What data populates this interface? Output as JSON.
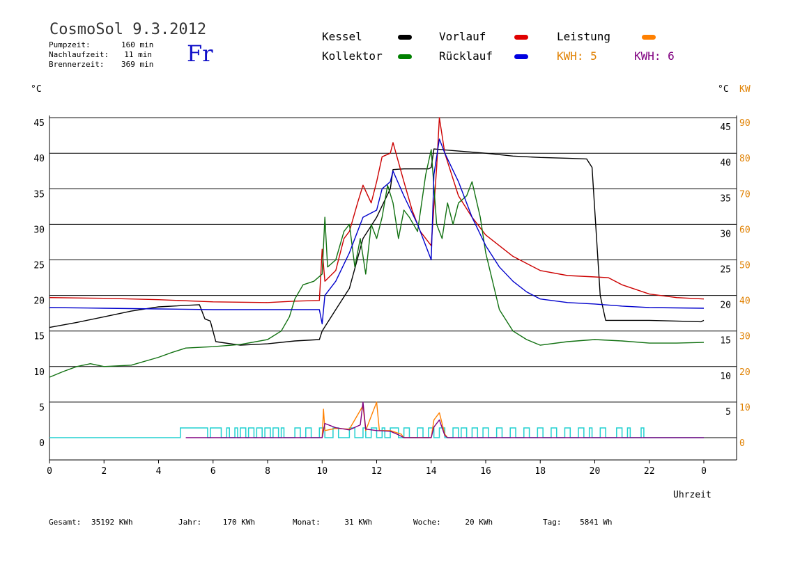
{
  "header": {
    "title": "CosmoSol 9.3.2012",
    "day": "Fr",
    "stats": [
      {
        "label": "Pumpzeit:",
        "value": "160 min"
      },
      {
        "label": "Nachlaufzeit:",
        "value": "11 min"
      },
      {
        "label": "Brennerzeit:",
        "value": "369 min"
      }
    ]
  },
  "legend": [
    {
      "name": "Kessel",
      "color": "#000000"
    },
    {
      "name": "Vorlauf",
      "color": "#e00000"
    },
    {
      "name": "Leistung",
      "color": "#ff8000"
    },
    {
      "name": "Kollektor",
      "color": "#008000"
    },
    {
      "name": "Rücklauf",
      "color": "#0000e0"
    }
  ],
  "kwh": [
    {
      "text": "KWH: 5",
      "color": "#e08000"
    },
    {
      "text": "KWH: 6",
      "color": "#800080"
    }
  ],
  "footer": [
    {
      "label": "Gesamt:",
      "value": "35192 KWh"
    },
    {
      "label": "Jahr:",
      "value": "170 KWh"
    },
    {
      "label": "Monat:",
      "value": "31 KWh"
    },
    {
      "label": "Woche:",
      "value": "20 KWh"
    },
    {
      "label": "Tag:",
      "value": "5841 Wh"
    }
  ],
  "chart_data": {
    "type": "line",
    "xlabel": "Uhrzeit",
    "ylabel_left": "°C",
    "ylabel_right": "°C",
    "ylabel_kw": "KW",
    "x_ticks": [
      "0",
      "2",
      "4",
      "6",
      "8",
      "10",
      "12",
      "14",
      "16",
      "18",
      "20",
      "22",
      "0"
    ],
    "y_ticks_left": [
      "0",
      "5",
      "10",
      "15",
      "20",
      "25",
      "30",
      "35",
      "40",
      "45"
    ],
    "y_ticks_right": [
      "5",
      "10",
      "15",
      "20",
      "25",
      "30",
      "35",
      "40",
      "45"
    ],
    "y_ticks_kw": [
      "0",
      "10",
      "20",
      "30",
      "40",
      "50",
      "60",
      "70",
      "80",
      "90"
    ],
    "xlim": [
      0,
      24
    ],
    "ylim": [
      0,
      45
    ],
    "grid": true,
    "series": [
      {
        "name": "Kessel",
        "color": "#000000",
        "points": [
          [
            0,
            15.5
          ],
          [
            1,
            16.2
          ],
          [
            2,
            17
          ],
          [
            3,
            17.8
          ],
          [
            4,
            18.4
          ],
          [
            5.5,
            18.7
          ],
          [
            5.7,
            16.7
          ],
          [
            5.9,
            16.4
          ],
          [
            6.1,
            13.5
          ],
          [
            7,
            13
          ],
          [
            8,
            13.2
          ],
          [
            9,
            13.6
          ],
          [
            9.9,
            13.8
          ],
          [
            10,
            15
          ],
          [
            10.5,
            18
          ],
          [
            11,
            21
          ],
          [
            11.5,
            28
          ],
          [
            12,
            31
          ],
          [
            12.5,
            35
          ],
          [
            12.6,
            37.7
          ],
          [
            13,
            37.8
          ],
          [
            13.9,
            37.8
          ],
          [
            14,
            38
          ],
          [
            14.1,
            40.6
          ],
          [
            15,
            40.3
          ],
          [
            16,
            40
          ],
          [
            17,
            39.6
          ],
          [
            18,
            39.4
          ],
          [
            19,
            39.3
          ],
          [
            19.7,
            39.2
          ],
          [
            19.9,
            38
          ],
          [
            20.2,
            20
          ],
          [
            20.4,
            16.5
          ],
          [
            21,
            16.5
          ],
          [
            22,
            16.5
          ],
          [
            23,
            16.4
          ],
          [
            23.9,
            16.3
          ],
          [
            24,
            16.5
          ]
        ]
      },
      {
        "name": "Vorlauf",
        "color": "#cc0000",
        "points": [
          [
            0,
            19.7
          ],
          [
            2,
            19.6
          ],
          [
            4,
            19.4
          ],
          [
            6,
            19.1
          ],
          [
            8,
            19
          ],
          [
            9,
            19.2
          ],
          [
            9.9,
            19.3
          ],
          [
            10,
            26.5
          ],
          [
            10.1,
            22
          ],
          [
            10.5,
            23.5
          ],
          [
            10.8,
            28
          ],
          [
            11,
            29
          ],
          [
            11.3,
            33
          ],
          [
            11.5,
            35.5
          ],
          [
            11.8,
            33
          ],
          [
            12,
            36
          ],
          [
            12.2,
            39.5
          ],
          [
            12.5,
            40
          ],
          [
            12.6,
            41.5
          ],
          [
            13,
            36
          ],
          [
            13.3,
            32
          ],
          [
            13.6,
            29
          ],
          [
            14,
            27
          ],
          [
            14.2,
            38
          ],
          [
            14.3,
            45
          ],
          [
            14.5,
            40
          ],
          [
            15,
            34
          ],
          [
            15.5,
            31
          ],
          [
            16,
            28.5
          ],
          [
            17,
            25.5
          ],
          [
            18,
            23.5
          ],
          [
            19,
            22.8
          ],
          [
            20,
            22.6
          ],
          [
            20.5,
            22.5
          ],
          [
            21,
            21.5
          ],
          [
            22,
            20.2
          ],
          [
            23,
            19.7
          ],
          [
            24,
            19.5
          ]
        ]
      },
      {
        "name": "Kollektor",
        "color": "#107010",
        "points": [
          [
            0,
            8.5
          ],
          [
            0.5,
            9.3
          ],
          [
            1,
            10
          ],
          [
            1.5,
            10.4
          ],
          [
            2,
            10
          ],
          [
            3,
            10.2
          ],
          [
            4,
            11.3
          ],
          [
            4.5,
            12
          ],
          [
            5,
            12.6
          ],
          [
            6,
            12.8
          ],
          [
            7,
            13.1
          ],
          [
            8,
            13.8
          ],
          [
            8.5,
            15
          ],
          [
            8.8,
            17
          ],
          [
            9,
            19.5
          ],
          [
            9.3,
            21.5
          ],
          [
            9.7,
            22
          ],
          [
            10,
            23
          ],
          [
            10.1,
            31
          ],
          [
            10.2,
            24
          ],
          [
            10.5,
            25
          ],
          [
            10.8,
            29
          ],
          [
            11,
            30
          ],
          [
            11.2,
            24
          ],
          [
            11.4,
            28
          ],
          [
            11.6,
            23
          ],
          [
            11.8,
            30
          ],
          [
            12,
            28
          ],
          [
            12.2,
            31
          ],
          [
            12.4,
            35.5
          ],
          [
            12.6,
            33
          ],
          [
            12.8,
            28
          ],
          [
            13,
            32
          ],
          [
            13.2,
            31
          ],
          [
            13.5,
            29
          ],
          [
            13.8,
            37
          ],
          [
            14,
            40.5
          ],
          [
            14.2,
            30
          ],
          [
            14.4,
            28
          ],
          [
            14.6,
            33
          ],
          [
            14.8,
            30
          ],
          [
            15,
            33
          ],
          [
            15.3,
            34
          ],
          [
            15.5,
            36
          ],
          [
            15.8,
            31
          ],
          [
            16,
            26
          ],
          [
            16.5,
            18
          ],
          [
            17,
            15
          ],
          [
            17.5,
            13.8
          ],
          [
            18,
            13
          ],
          [
            19,
            13.5
          ],
          [
            20,
            13.8
          ],
          [
            21,
            13.6
          ],
          [
            22,
            13.3
          ],
          [
            23,
            13.3
          ],
          [
            24,
            13.4
          ]
        ]
      },
      {
        "name": "Rücklauf",
        "color": "#0000cc",
        "points": [
          [
            0,
            18.3
          ],
          [
            2,
            18.2
          ],
          [
            4,
            18.1
          ],
          [
            6,
            18
          ],
          [
            8,
            18
          ],
          [
            9,
            18
          ],
          [
            9.9,
            18
          ],
          [
            10,
            16
          ],
          [
            10.1,
            20
          ],
          [
            10.5,
            22
          ],
          [
            11,
            26
          ],
          [
            11.5,
            31
          ],
          [
            12,
            32
          ],
          [
            12.2,
            35
          ],
          [
            12.5,
            36
          ],
          [
            12.6,
            37.5
          ],
          [
            13,
            34
          ],
          [
            13.5,
            30
          ],
          [
            14,
            25
          ],
          [
            14.1,
            37
          ],
          [
            14.3,
            42
          ],
          [
            14.5,
            40
          ],
          [
            15,
            36
          ],
          [
            15.5,
            31
          ],
          [
            16,
            27
          ],
          [
            16.5,
            24
          ],
          [
            17,
            22
          ],
          [
            17.5,
            20.5
          ],
          [
            18,
            19.5
          ],
          [
            19,
            19
          ],
          [
            20,
            18.8
          ],
          [
            21,
            18.5
          ],
          [
            22,
            18.3
          ],
          [
            24,
            18.2
          ]
        ]
      }
    ],
    "leistung_series": [
      {
        "name": "KWH: 5",
        "color": "#ff8000",
        "points": [
          [
            10,
            0
          ],
          [
            10.05,
            4
          ],
          [
            10.1,
            1
          ],
          [
            10.5,
            1.3
          ],
          [
            11,
            1.2
          ],
          [
            11.5,
            4.5
          ],
          [
            11.6,
            1
          ],
          [
            12,
            5
          ],
          [
            12.1,
            1
          ],
          [
            12.5,
            1
          ],
          [
            12.9,
            0.5
          ],
          [
            13,
            0
          ],
          [
            14,
            0
          ],
          [
            14.1,
            2.5
          ],
          [
            14.3,
            3.5
          ],
          [
            14.5,
            0.5
          ],
          [
            14.6,
            0
          ]
        ]
      },
      {
        "name": "KWH: 6",
        "color": "#800080",
        "points": [
          [
            5,
            0
          ],
          [
            10,
            0
          ],
          [
            10.1,
            2
          ],
          [
            10.5,
            1.4
          ],
          [
            11,
            1.1
          ],
          [
            11.4,
            1.8
          ],
          [
            11.5,
            5
          ],
          [
            11.6,
            1.2
          ],
          [
            12,
            1
          ],
          [
            12.5,
            0.9
          ],
          [
            12.8,
            0.4
          ],
          [
            13,
            0
          ],
          [
            14,
            0
          ],
          [
            14.1,
            1.5
          ],
          [
            14.3,
            2.5
          ],
          [
            14.5,
            0.3
          ],
          [
            14.6,
            0
          ],
          [
            24,
            0
          ]
        ]
      }
    ],
    "pump_state": {
      "color": "#20d0d0",
      "on_intervals": [
        [
          4.8,
          5.8
        ],
        [
          5.9,
          6.3
        ],
        [
          6.5,
          6.6
        ],
        [
          6.8,
          6.9
        ],
        [
          7,
          7.2
        ],
        [
          7.3,
          7.5
        ],
        [
          7.6,
          7.8
        ],
        [
          7.9,
          8.1
        ],
        [
          8.2,
          8.4
        ],
        [
          8.5,
          8.6
        ],
        [
          9,
          9.2
        ],
        [
          9.4,
          9.6
        ],
        [
          9.9,
          10.1
        ],
        [
          10.4,
          10.6
        ],
        [
          11,
          11.2
        ],
        [
          11.5,
          11.6
        ],
        [
          11.8,
          12
        ],
        [
          12.2,
          12.3
        ],
        [
          12.5,
          12.8
        ],
        [
          13,
          13.2
        ],
        [
          13.5,
          13.7
        ],
        [
          13.9,
          14.1
        ],
        [
          14.3,
          14.5
        ],
        [
          14.8,
          15
        ],
        [
          15.1,
          15.3
        ],
        [
          15.5,
          15.7
        ],
        [
          15.9,
          16.1
        ],
        [
          16.4,
          16.6
        ],
        [
          16.9,
          17.1
        ],
        [
          17.4,
          17.6
        ],
        [
          17.9,
          18.1
        ],
        [
          18.4,
          18.6
        ],
        [
          18.9,
          19.1
        ],
        [
          19.4,
          19.6
        ],
        [
          19.8,
          19.9
        ],
        [
          20.2,
          20.4
        ],
        [
          20.8,
          21
        ],
        [
          21.2,
          21.3
        ],
        [
          21.7,
          21.8
        ]
      ]
    }
  }
}
